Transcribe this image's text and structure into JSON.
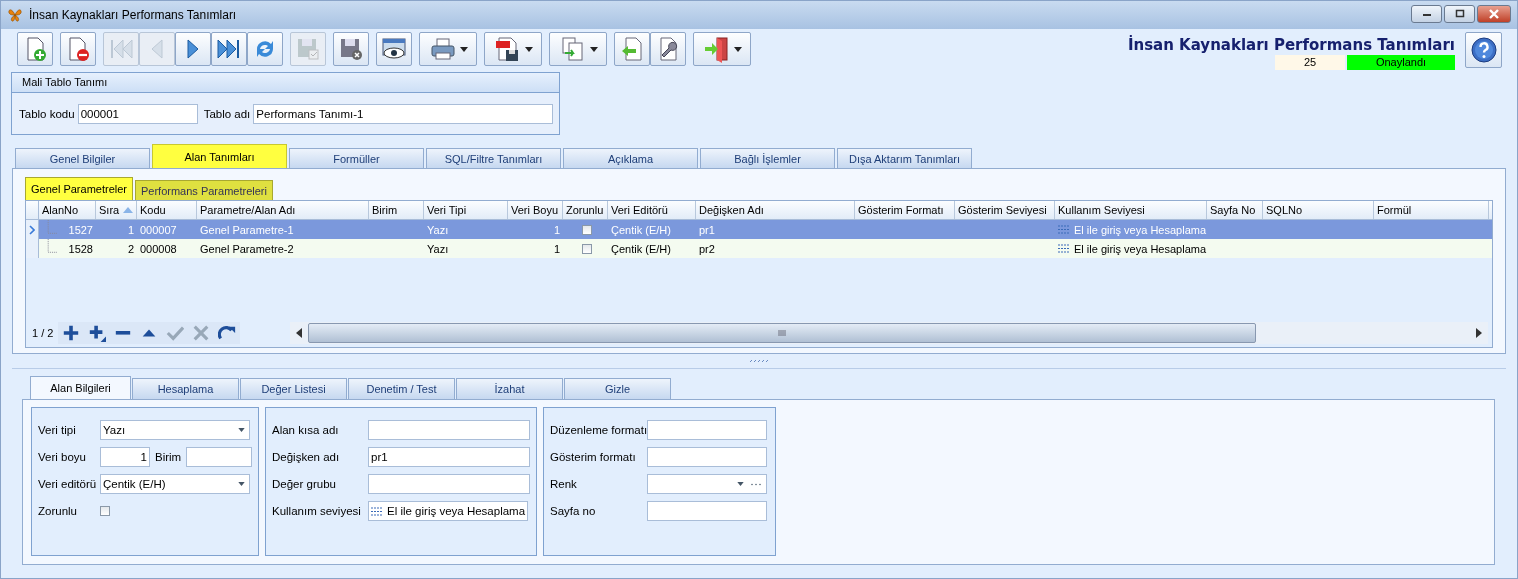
{
  "window": {
    "title": "İnsan Kaynakları Performans Tanımları"
  },
  "toolbar": {
    "groups": [
      [
        {
          "kind": "new",
          "disabled": false,
          "dropdown": false
        }
      ],
      [
        {
          "kind": "delete",
          "disabled": false,
          "dropdown": false
        }
      ],
      [
        {
          "kind": "first",
          "disabled": true,
          "dropdown": false
        },
        {
          "kind": "prev",
          "disabled": true,
          "dropdown": false
        },
        {
          "kind": "next",
          "disabled": false,
          "dropdown": false
        },
        {
          "kind": "last",
          "disabled": false,
          "dropdown": false
        },
        {
          "kind": "refresh",
          "disabled": false,
          "dropdown": false
        }
      ],
      [
        {
          "kind": "save",
          "disabled": true,
          "dropdown": false
        }
      ],
      [
        {
          "kind": "cancel",
          "disabled": false,
          "dropdown": false
        }
      ],
      [
        {
          "kind": "preview",
          "disabled": false,
          "dropdown": false
        }
      ],
      [
        {
          "kind": "print",
          "disabled": false,
          "dropdown": true
        }
      ],
      [
        {
          "kind": "pdf",
          "disabled": false,
          "dropdown": true
        }
      ],
      [
        {
          "kind": "export",
          "disabled": false,
          "dropdown": true
        }
      ],
      [
        {
          "kind": "import",
          "disabled": false,
          "dropdown": false
        },
        {
          "kind": "settings",
          "disabled": false,
          "dropdown": false
        }
      ],
      [
        {
          "kind": "exit",
          "disabled": false,
          "dropdown": true
        }
      ]
    ]
  },
  "header": {
    "title": "İnsan Kaynakları Performans Tanımları",
    "record_no": "25",
    "status": "Onaylandı"
  },
  "table_definition": {
    "title": "Mali Tablo Tanımı",
    "tablo_kodu_label": "Tablo kodu",
    "tablo_kodu": "000001",
    "tablo_adi_label": "Tablo adı",
    "tablo_adi": "Performans Tanımı-1"
  },
  "tabs": [
    {
      "label": "Genel Bilgiler",
      "selected": false
    },
    {
      "label": "Alan Tanımları",
      "selected": true
    },
    {
      "label": "Formüller",
      "selected": false
    },
    {
      "label": "SQL/Filtre Tanımları",
      "selected": false
    },
    {
      "label": "Açıklama",
      "selected": false
    },
    {
      "label": "Bağlı İşlemler",
      "selected": false
    },
    {
      "label": "Dışa Aktarım Tanımları",
      "selected": false
    }
  ],
  "sub_tabs": [
    {
      "label": "Genel Parametreler",
      "selected": true
    },
    {
      "label": "Performans Parametreleri",
      "selected": false
    }
  ],
  "grid": {
    "columns": [
      {
        "label": "AlanNo",
        "sorted": false
      },
      {
        "label": "Sıra",
        "sorted": true
      },
      {
        "label": "Kodu",
        "sorted": false
      },
      {
        "label": "Parametre/Alan Adı",
        "sorted": false
      },
      {
        "label": "Birim",
        "sorted": false
      },
      {
        "label": "Veri Tipi",
        "sorted": false
      },
      {
        "label": "Veri Boyu",
        "sorted": false
      },
      {
        "label": "Zorunlu",
        "sorted": false
      },
      {
        "label": "Veri Editörü",
        "sorted": false
      },
      {
        "label": "Değişken Adı",
        "sorted": false
      },
      {
        "label": "Gösterim Formatı",
        "sorted": false
      },
      {
        "label": "Gösterim Seviyesi",
        "sorted": false
      },
      {
        "label": "Kullanım Seviyesi",
        "sorted": false
      },
      {
        "label": "Sayfa No",
        "sorted": false
      },
      {
        "label": "SQLNo",
        "sorted": false
      },
      {
        "label": "Formül",
        "sorted": false
      }
    ],
    "rows": [
      {
        "selected": true,
        "alan_no": "1527",
        "sira": "1",
        "kodu": "000007",
        "parametre_alan_adi": "Genel Parametre-1",
        "veri_tipi": "Yazı",
        "veri_boyu": "1",
        "zorunlu": false,
        "veri_editoru": "Çentik (E/H)",
        "degisken_adi": "pr1",
        "kullanim_seviyesi": "El ile giriş veya Hesaplama"
      },
      {
        "selected": false,
        "alan_no": "1528",
        "sira": "2",
        "kodu": "000008",
        "parametre_alan_adi": "Genel Parametre-2",
        "veri_tipi": "Yazı",
        "veri_boyu": "1",
        "zorunlu": false,
        "veri_editoru": "Çentik (E/H)",
        "degisken_adi": "pr2",
        "kullanim_seviyesi": "El ile giriş veya Hesaplama"
      }
    ],
    "record_counter": "1 / 2",
    "navigator": [
      {
        "kind": "add",
        "disabled": false
      },
      {
        "kind": "add-child",
        "disabled": false
      },
      {
        "kind": "remove",
        "disabled": false
      },
      {
        "kind": "up",
        "disabled": false
      },
      {
        "kind": "confirm",
        "disabled": true
      },
      {
        "kind": "cancel",
        "disabled": true
      },
      {
        "kind": "redo",
        "disabled": false
      }
    ]
  },
  "detail_tabs": [
    {
      "label": "Alan Bilgileri",
      "selected": true
    },
    {
      "label": "Hesaplama",
      "selected": false
    },
    {
      "label": "Değer Listesi",
      "selected": false
    },
    {
      "label": "Denetim / Test",
      "selected": false
    },
    {
      "label": "İzahat",
      "selected": false
    },
    {
      "label": "Gizle",
      "selected": false
    }
  ],
  "detail_groups": [
    [
      {
        "label": "Veri tipi",
        "kind": "combo",
        "value": "Yazı"
      },
      {
        "label": "Veri boyu",
        "kind": "number",
        "value": "1",
        "unit_label": "Birim"
      },
      {
        "label": "Veri editörü",
        "kind": "combo",
        "value": "Çentik (E/H)"
      },
      {
        "label": "Zorunlu",
        "kind": "checkbox",
        "checked": false
      }
    ],
    [
      {
        "label": "Alan kısa adı",
        "kind": "text"
      },
      {
        "label": "Değişken adı",
        "kind": "text",
        "value": "pr1"
      },
      {
        "label": "Değer grubu",
        "kind": "text"
      },
      {
        "label": "Kullanım seviyesi",
        "kind": "icon-combo",
        "value": "El ile giriş veya Hesaplama"
      }
    ],
    [
      {
        "label": "Düzenleme formatı",
        "kind": "text"
      },
      {
        "label": "Gösterim formatı",
        "kind": "text"
      },
      {
        "label": "Renk",
        "kind": "color"
      },
      {
        "label": "Sayfa no",
        "kind": "text"
      }
    ]
  ]
}
